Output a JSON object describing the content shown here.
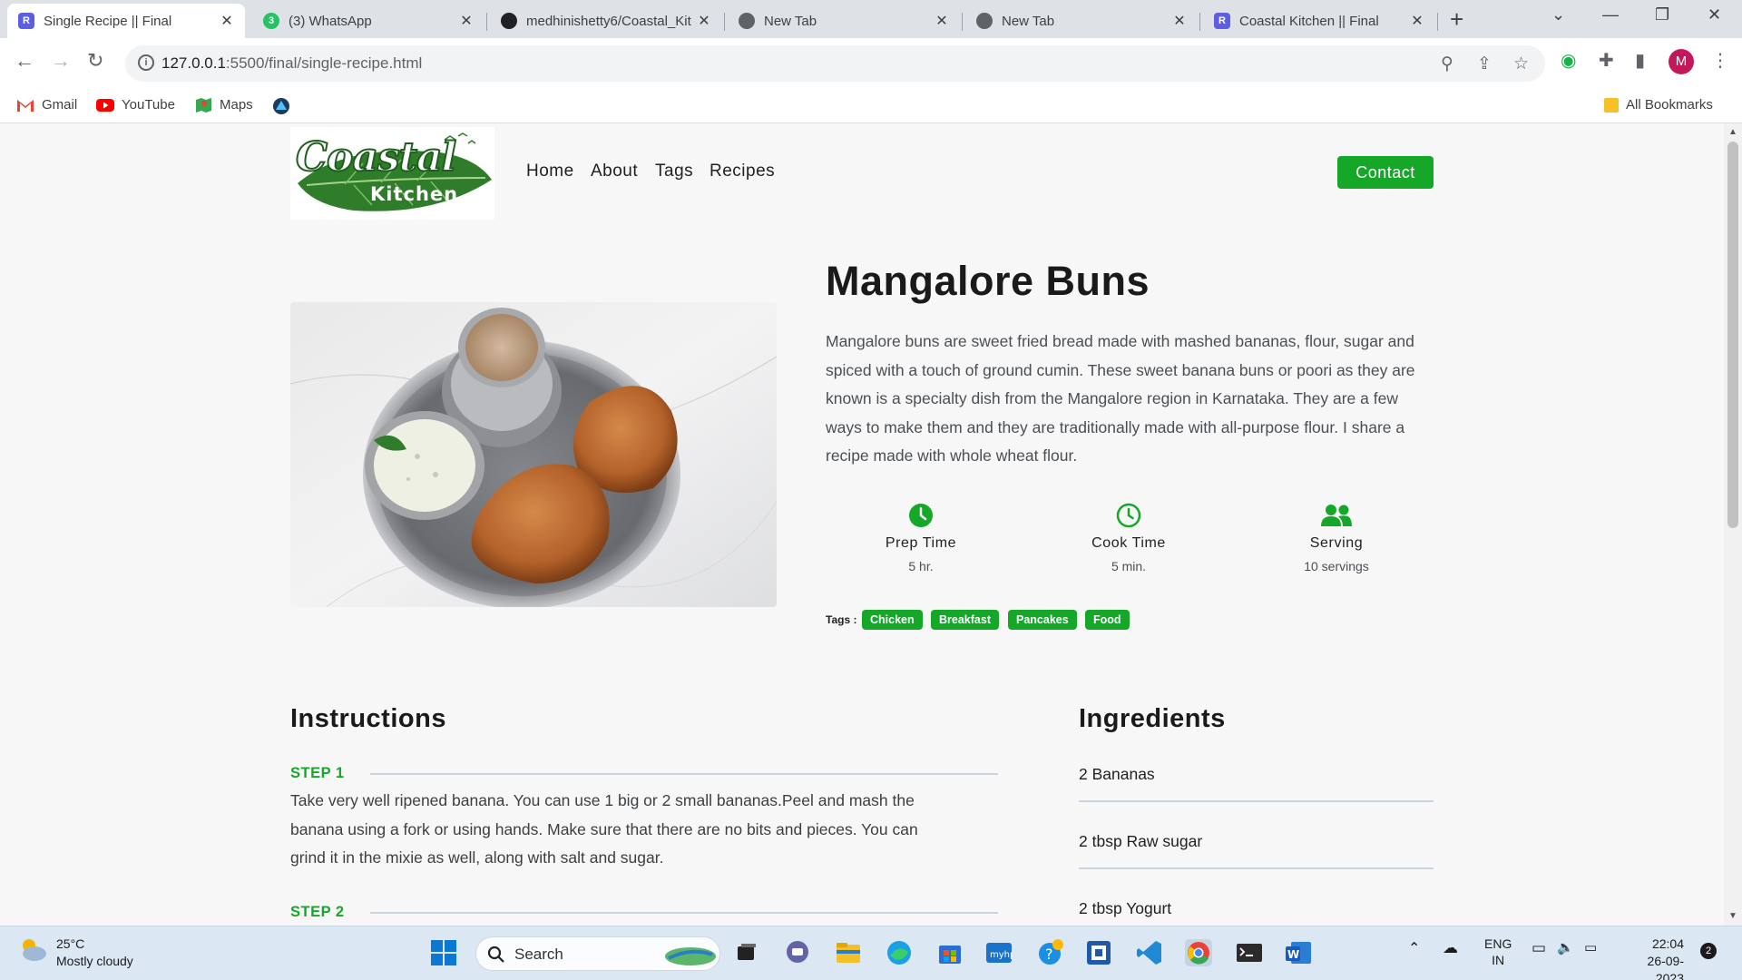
{
  "browser": {
    "tabs": [
      {
        "title": "Single Recipe || Final",
        "active": true,
        "icon": "r-favicon"
      },
      {
        "title": "(3) WhatsApp",
        "active": false,
        "icon": "whatsapp-icon"
      },
      {
        "title": "medhinishetty6/Coastal_Kit",
        "active": false,
        "icon": "github-icon"
      },
      {
        "title": "New Tab",
        "active": false,
        "icon": "chrome-icon"
      },
      {
        "title": "New Tab",
        "active": false,
        "icon": "chrome-icon"
      },
      {
        "title": "Coastal Kitchen || Final",
        "active": false,
        "icon": "r-favicon"
      }
    ],
    "url_host": "127.0.0.1",
    "url_rest": ":5500/final/single-recipe.html",
    "avatar_letter": "M",
    "bookmarks": [
      {
        "label": "Gmail"
      },
      {
        "label": "YouTube"
      },
      {
        "label": "Maps"
      }
    ],
    "all_bookmarks": "All Bookmarks"
  },
  "site": {
    "logo_text_top": "Coastal",
    "logo_text_bottom": "Kitchen",
    "nav": [
      "Home",
      "About",
      "Tags",
      "Recipes"
    ],
    "contact": "Contact"
  },
  "recipe": {
    "title": "Mangalore Buns",
    "description": "Mangalore buns are sweet fried bread made with mashed bananas, flour, sugar and spiced with a touch of ground cumin. These sweet banana buns or poori as they are known is a specialty dish from the Mangalore region in Karnataka. They are a few ways to make them and they are traditionally made with all-purpose flour. I share a recipe made with whole wheat flour.",
    "stats": [
      {
        "label": "Prep Time",
        "value": "5 hr.",
        "icon": "clock-solid-icon"
      },
      {
        "label": "Cook Time",
        "value": "5 min.",
        "icon": "clock-outline-icon"
      },
      {
        "label": "Serving",
        "value": "10 servings",
        "icon": "users-icon"
      }
    ],
    "tags_label": "Tags :",
    "tags": [
      "Chicken",
      "Breakfast",
      "Pancakes",
      "Food"
    ],
    "instructions_title": "Instructions",
    "steps": [
      {
        "label": "STEP 1",
        "text": "Take very well ripened banana. You can use 1 big or 2 small bananas.Peel and mash the banana using a fork or using hands. Make sure that there are no bits and pieces. You can grind it in the mixie as well, along with salt and sugar."
      },
      {
        "label": "STEP 2",
        "text": ""
      }
    ],
    "ingredients_title": "Ingredients",
    "ingredients": [
      "2 Bananas",
      "2 tbsp Raw sugar",
      "2 tbsp Yogurt"
    ]
  },
  "taskbar": {
    "temp": "25°C",
    "weather": "Mostly cloudy",
    "search": "Search",
    "lang1": "ENG",
    "lang2": "IN",
    "time": "22:04",
    "date": "26-09-2023",
    "notif_count": "2"
  },
  "colors": {
    "accent_green": "#15a828",
    "tab_bar": "#dee1e6"
  }
}
